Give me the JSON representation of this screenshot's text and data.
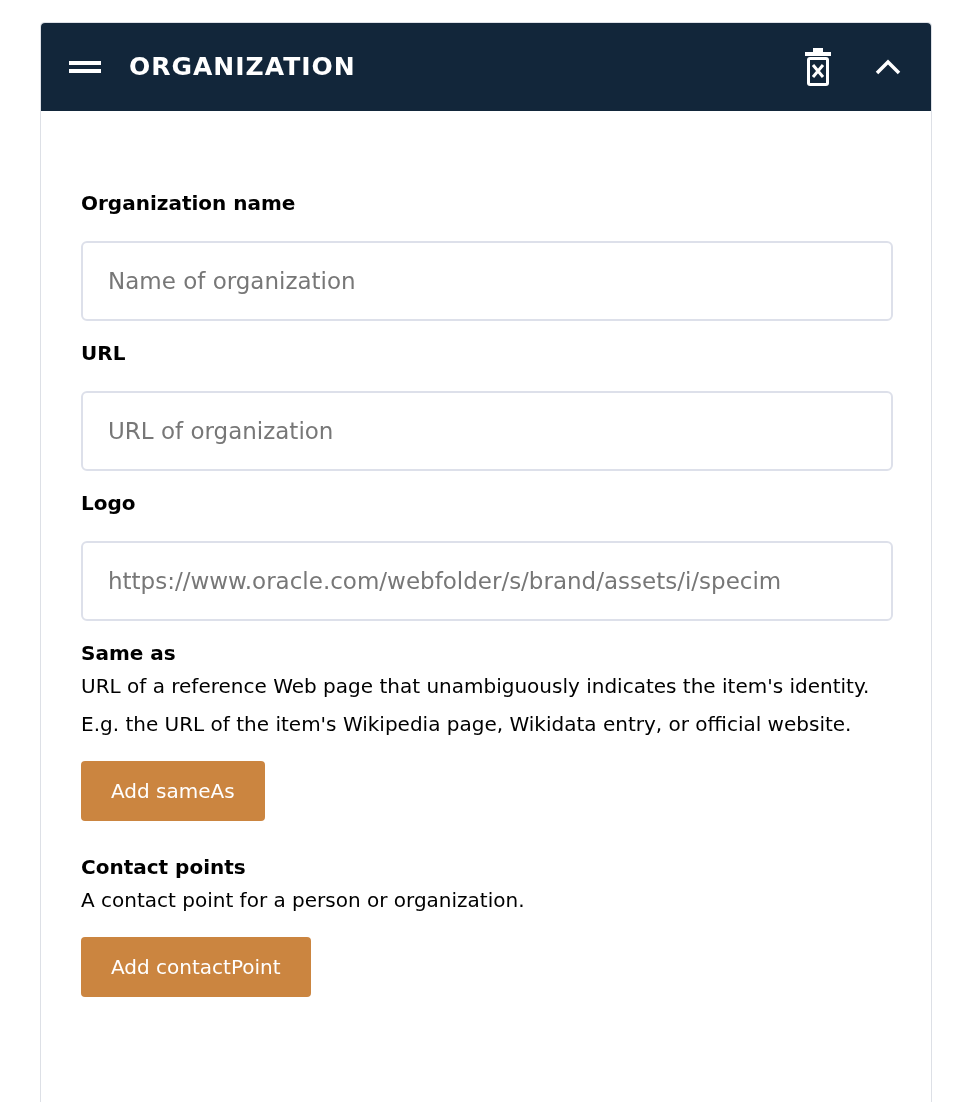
{
  "panel": {
    "title": "ORGANIZATION",
    "expanded": true
  },
  "fields": [
    {
      "kind": "input",
      "label": "Organization name",
      "placeholder": "Name of organization"
    },
    {
      "kind": "input",
      "label": "URL",
      "placeholder": "URL of organization"
    },
    {
      "kind": "input",
      "label": "Logo",
      "placeholder": "https://www.oracle.com/webfolder/s/brand/assets/i/specim"
    },
    {
      "kind": "list",
      "label": "Same as",
      "description": "URL of a reference Web page that unambiguously indicates the item's identity. E.g. the URL of the item's Wikipedia page, Wikidata entry, or official website.",
      "button": "Add sameAs"
    },
    {
      "kind": "list",
      "label": "Contact points",
      "description": "A contact point for a person or organization.",
      "button": "Add contactPoint"
    }
  ]
}
